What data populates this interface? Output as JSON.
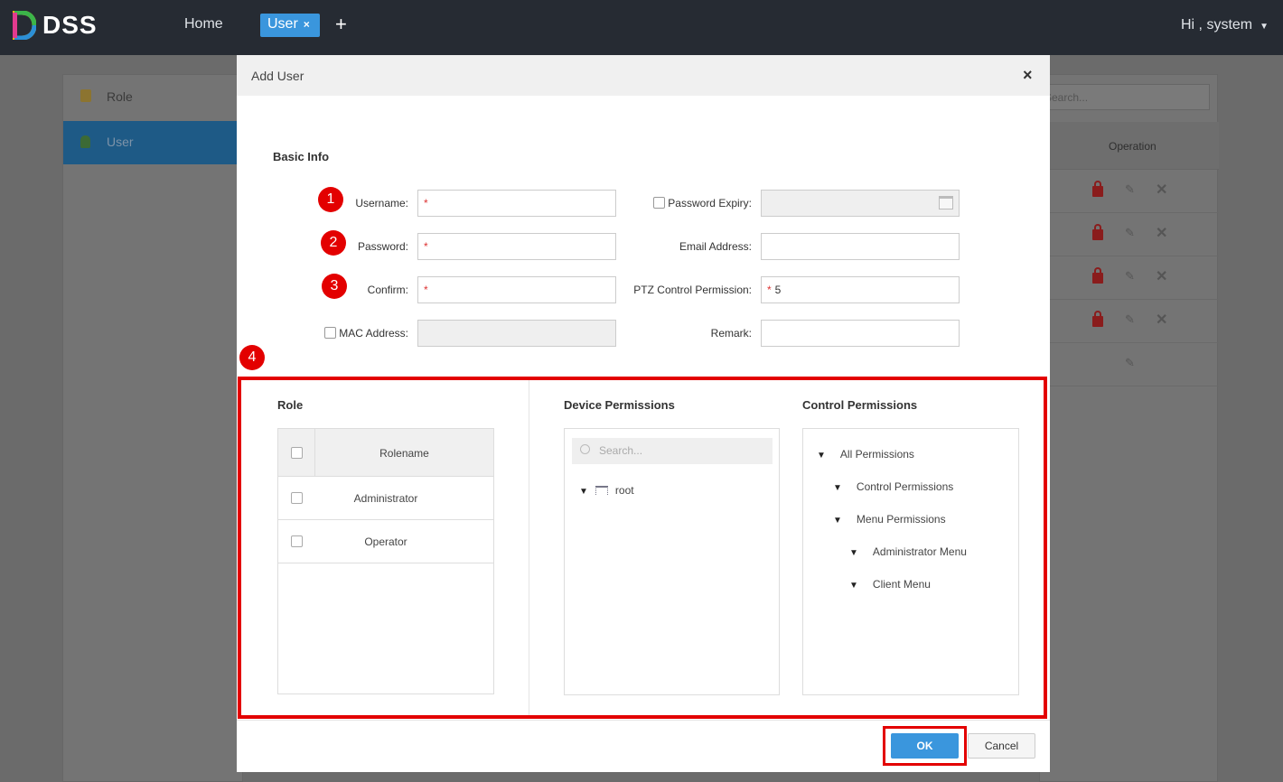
{
  "topbar": {
    "brand": "DSS",
    "home": "Home",
    "active_tab": "User",
    "tab_close": "×",
    "add_tab": "+",
    "greeting": "Hi , system",
    "caret": "▼"
  },
  "left_menu": [
    {
      "label": "Role",
      "icon": "lock-icon"
    },
    {
      "label": "User",
      "icon": "user-icon"
    }
  ],
  "right_panel": {
    "search_placeholder": "Search...",
    "operation_header": "Operation"
  },
  "modal": {
    "title": "Add User",
    "close": "×",
    "basic_info": "Basic Info",
    "fields": {
      "username": {
        "label": "Username:",
        "value": "",
        "required": "*"
      },
      "password": {
        "label": "Password:",
        "value": "",
        "required": "*"
      },
      "confirm": {
        "label": "Confirm:",
        "value": "",
        "required": "*"
      },
      "mac": {
        "label": "MAC Address:",
        "value": ""
      },
      "password_expiry": {
        "label": "Password Expiry:",
        "value": ""
      },
      "email": {
        "label": "Email Address:",
        "value": ""
      },
      "ptz": {
        "label": "PTZ Control Permission:",
        "value": "5",
        "required": "*"
      },
      "remark": {
        "label": "Remark:",
        "value": ""
      }
    },
    "markers": [
      "1",
      "2",
      "3",
      "4"
    ],
    "role": {
      "title": "Role",
      "column": "Rolename",
      "rows": [
        "Administrator",
        "Operator"
      ]
    },
    "device": {
      "title": "Device Permissions",
      "search_placeholder": "Search...",
      "tree": [
        "root"
      ]
    },
    "control": {
      "title": "Control Permissions",
      "tree": [
        "All Permissions",
        "Control Permissions",
        "Menu Permissions",
        "Administrator Menu",
        "Client Menu"
      ]
    },
    "ok": "OK",
    "cancel": "Cancel"
  },
  "colors": {
    "accent": "#3a96dd",
    "highlight": "#e30000",
    "topbar": "#262b33"
  }
}
